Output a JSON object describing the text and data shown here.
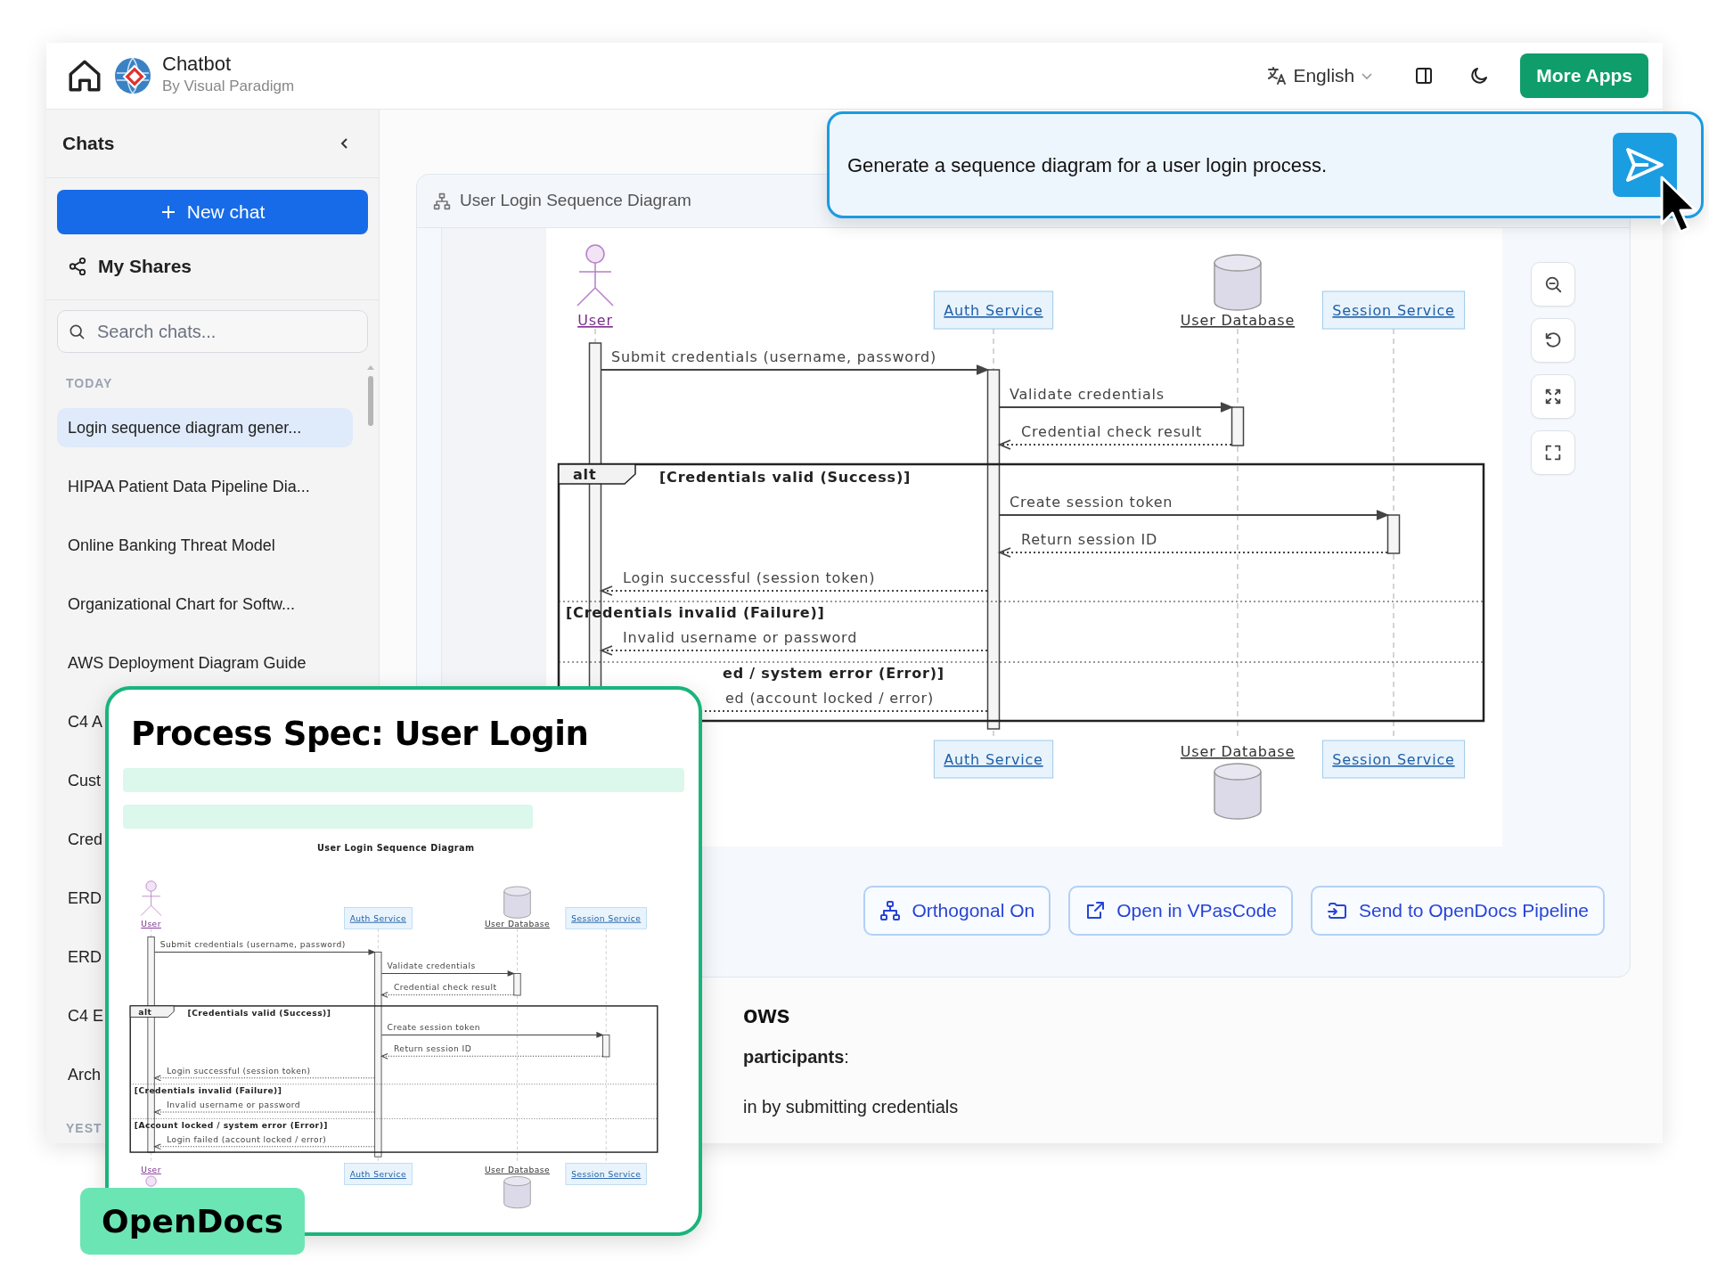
{
  "header": {
    "title": "Chatbot",
    "subtitle": "By Visual Paradigm",
    "language": "English",
    "more_apps": "More Apps"
  },
  "sidebar": {
    "title": "Chats",
    "new_chat": "New chat",
    "my_shares": "My Shares",
    "search": {
      "placeholder": "Search chats..."
    },
    "sections": [
      {
        "kind": "heading",
        "label": "TODAY"
      },
      {
        "kind": "chat",
        "label": "Login sequence diagram gener...",
        "selected": true
      },
      {
        "kind": "chat",
        "label": "HIPAA Patient Data Pipeline Dia...",
        "selected": false
      },
      {
        "kind": "chat",
        "label": "Online Banking Threat Model",
        "selected": false
      },
      {
        "kind": "chat",
        "label": "Organizational Chart for Softw...",
        "selected": false
      },
      {
        "kind": "chat",
        "label": "AWS Deployment Diagram Guide",
        "selected": false
      },
      {
        "kind": "chat",
        "label": "C4 A",
        "selected": false
      },
      {
        "kind": "chat",
        "label": "Cust",
        "selected": false
      },
      {
        "kind": "chat",
        "label": "Cred",
        "selected": false
      },
      {
        "kind": "chat",
        "label": "ERD",
        "selected": false
      },
      {
        "kind": "chat",
        "label": "ERD",
        "selected": false
      },
      {
        "kind": "chat",
        "label": "C4 E",
        "selected": false
      },
      {
        "kind": "chat",
        "label": "Arch",
        "selected": false
      },
      {
        "kind": "heading",
        "label": "YEST"
      }
    ]
  },
  "prompt": {
    "text": "Generate a sequence diagram for a user login process."
  },
  "diagram_panel": {
    "title": "User Login Sequence Diagram",
    "tools": [
      {
        "kind": "zoom_out"
      },
      {
        "kind": "reset"
      },
      {
        "kind": "fit"
      },
      {
        "kind": "fullscreen"
      }
    ],
    "diagram": {
      "participants": [
        {
          "kind": "actor",
          "label": "User"
        },
        {
          "kind": "service",
          "label": "Auth Service"
        },
        {
          "kind": "database",
          "label": "User Database"
        },
        {
          "kind": "service",
          "label": "Session Service"
        }
      ],
      "messages": [
        {
          "kind": "call",
          "label": "Submit credentials (username, password)",
          "cut": false
        },
        {
          "kind": "call",
          "label": "Validate credentials",
          "cut": false
        },
        {
          "kind": "return",
          "label": "Credential check result",
          "cut": false
        },
        {
          "kind": "call",
          "label": "Create session token",
          "cut": false
        },
        {
          "kind": "return",
          "label": "Return session ID",
          "cut": false
        },
        {
          "kind": "return",
          "label": "Login successful (session token)",
          "cut": false
        },
        {
          "kind": "return",
          "label": "Invalid username or password",
          "cut": false
        },
        {
          "kind": "return",
          "label": "ed (account locked / error)",
          "cut": true
        }
      ],
      "fragment": {
        "operator": "alt",
        "guards": [
          {
            "label": "[Credentials valid (Success)]",
            "cut": false
          },
          {
            "label": "[Credentials invalid (Failure)]",
            "cut": false
          },
          {
            "label": "ed / system error (Error)]",
            "cut": true
          }
        ]
      },
      "footer": [
        {
          "kind": "service",
          "label": "Auth Service"
        },
        {
          "kind": "database",
          "label": "User Database"
        },
        {
          "kind": "service",
          "label": "Session Service"
        }
      ]
    },
    "actions": [
      {
        "kind": "orthogonal",
        "label": "Orthogonal On"
      },
      {
        "kind": "open",
        "label": "Open in VPasCode"
      },
      {
        "kind": "send",
        "label": "Send to OpenDocs Pipeline"
      }
    ]
  },
  "section": {
    "heading": "ows",
    "lines": [
      "**participants**:",
      "in by submitting credentials"
    ]
  },
  "opendocs": {
    "title": "Process Spec: User Login",
    "tag": "OpenDocs",
    "diagram": {
      "title": "User Login Sequence Diagram",
      "participants": [
        {
          "kind": "actor",
          "label": "User"
        },
        {
          "kind": "service",
          "label": "Auth Service"
        },
        {
          "kind": "database",
          "label": "User Database"
        },
        {
          "kind": "service",
          "label": "Session Service"
        }
      ],
      "messages": [
        {
          "kind": "call",
          "label": "Submit credentials (username, password)",
          "cut": false
        },
        {
          "kind": "call",
          "label": "Validate credentials",
          "cut": false
        },
        {
          "kind": "return",
          "label": "Credential check result",
          "cut": false
        },
        {
          "kind": "call",
          "label": "Create session token",
          "cut": false
        },
        {
          "kind": "return",
          "label": "Return session ID",
          "cut": false
        },
        {
          "kind": "return",
          "label": "Login successful (session token)",
          "cut": false
        },
        {
          "kind": "return",
          "label": "Invalid username or password",
          "cut": false
        },
        {
          "kind": "return",
          "label": "Login failed (account locked / error)",
          "cut": false
        }
      ],
      "fragment": {
        "operator": "alt",
        "guards": [
          {
            "label": "[Credentials valid (Success)]",
            "cut": false
          },
          {
            "label": "[Credentials invalid (Failure)]",
            "cut": false
          },
          {
            "label": "[Account locked / system error (Error)]",
            "cut": false
          }
        ]
      },
      "footer": [
        {
          "kind": "actor",
          "label": "User"
        },
        {
          "kind": "service",
          "label": "Auth Service"
        },
        {
          "kind": "database",
          "label": "User Database"
        },
        {
          "kind": "service",
          "label": "Session Service"
        }
      ]
    }
  }
}
